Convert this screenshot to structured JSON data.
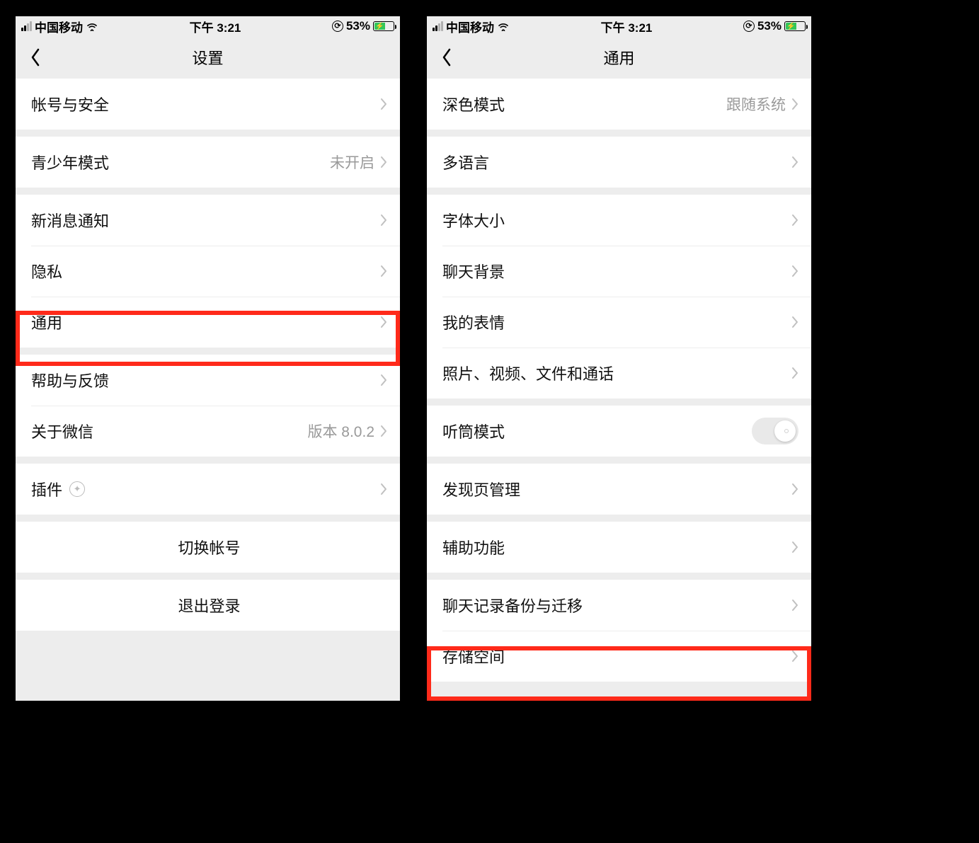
{
  "statusbar": {
    "carrier": "中国移动",
    "time": "下午 3:21",
    "battery_percent": "53%"
  },
  "screens": {
    "left": {
      "title": "设置",
      "rows": {
        "account_security": "帐号与安全",
        "youth_mode": "青少年模式",
        "youth_mode_value": "未开启",
        "new_message": "新消息通知",
        "privacy": "隐私",
        "general": "通用",
        "help": "帮助与反馈",
        "about": "关于微信",
        "about_value": "版本 8.0.2",
        "plugins": "插件",
        "switch_account": "切换帐号",
        "logout": "退出登录"
      }
    },
    "right": {
      "title": "通用",
      "rows": {
        "dark_mode": "深色模式",
        "dark_mode_value": "跟随系统",
        "language": "多语言",
        "font_size": "字体大小",
        "chat_bg": "聊天背景",
        "my_stickers": "我的表情",
        "media_files": "照片、视频、文件和通话",
        "earpiece": "听筒模式",
        "discover": "发现页管理",
        "accessibility": "辅助功能",
        "chat_backup": "聊天记录备份与迁移",
        "storage": "存储空间"
      }
    }
  }
}
